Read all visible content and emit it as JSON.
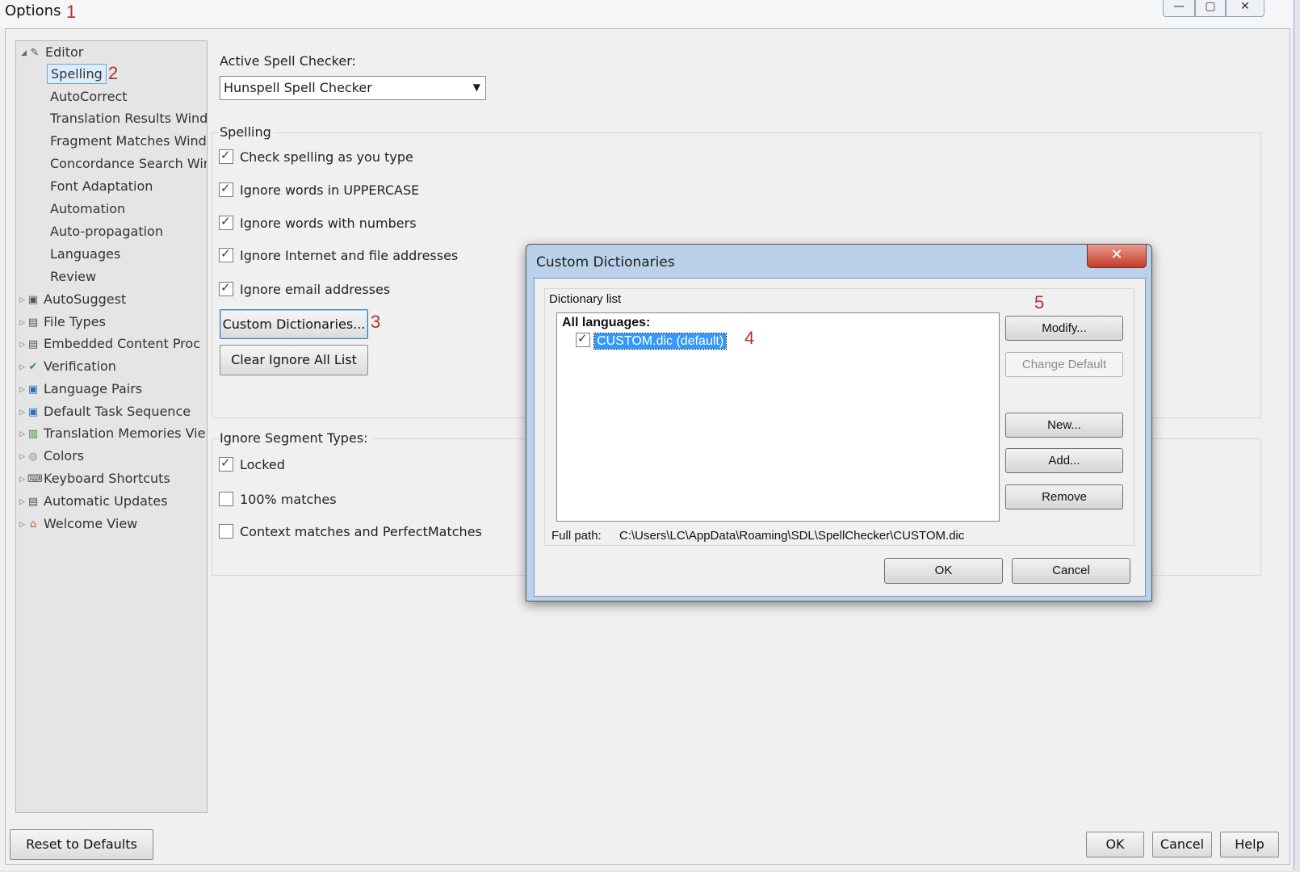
{
  "window": {
    "title": "Options",
    "controls": [
      "—",
      "▢",
      "✕"
    ]
  },
  "annotations": [
    "1",
    "2",
    "3",
    "4",
    "5"
  ],
  "tree": {
    "items": [
      {
        "label": "Editor",
        "icon": "pencil-icon",
        "expanded": true
      },
      {
        "label": "Spelling",
        "selected": true
      },
      {
        "label": "AutoCorrect"
      },
      {
        "label": "Translation Results Wind"
      },
      {
        "label": "Fragment Matches Wind"
      },
      {
        "label": "Concordance Search Win"
      },
      {
        "label": "Font Adaptation"
      },
      {
        "label": "Automation"
      },
      {
        "label": "Auto-propagation"
      },
      {
        "label": "Languages"
      },
      {
        "label": "Review"
      },
      {
        "label": "AutoSuggest",
        "icon": "autosuggest-icon"
      },
      {
        "label": "File Types",
        "icon": "file-types-icon"
      },
      {
        "label": "Embedded Content Proc",
        "icon": "embedded-content-icon"
      },
      {
        "label": "Verification",
        "icon": "verification-icon"
      },
      {
        "label": "Language Pairs",
        "icon": "language-pairs-icon"
      },
      {
        "label": "Default Task Sequence",
        "icon": "task-sequence-icon"
      },
      {
        "label": "Translation Memories Vie",
        "icon": "translation-memories-icon"
      },
      {
        "label": "Colors",
        "icon": "colors-icon"
      },
      {
        "label": "Keyboard Shortcuts",
        "icon": "keyboard-icon"
      },
      {
        "label": "Automatic Updates",
        "icon": "updates-icon"
      },
      {
        "label": "Welcome View",
        "icon": "home-icon"
      }
    ]
  },
  "spell": {
    "active_label": "Active Spell Checker:",
    "active_value": "Hunspell Spell Checker",
    "spelling_group": "Spelling",
    "options": [
      {
        "label": "Check spelling as you type",
        "checked": true
      },
      {
        "label": "Ignore words in UPPERCASE",
        "checked": true
      },
      {
        "label": "Ignore words with numbers",
        "checked": true
      },
      {
        "label": "Ignore Internet and file addresses",
        "checked": true
      },
      {
        "label": "Ignore email addresses",
        "checked": true
      }
    ],
    "custom_dict_button": "Custom Dictionaries...",
    "clear_ignore_button": "Clear Ignore All List",
    "ignore_group": "Ignore Segment Types:",
    "ignore_options": [
      {
        "label": "Locked",
        "checked": true
      },
      {
        "label": "100% matches",
        "checked": false
      },
      {
        "label": "Context matches and PerfectMatches",
        "checked": false
      }
    ]
  },
  "dialog": {
    "title": "Custom Dictionaries",
    "close": "✕",
    "group_label": "Dictionary list",
    "list_header": "All languages:",
    "dictionary": {
      "label": "CUSTOM.dic (default)",
      "checked": true
    },
    "buttons": {
      "modify": "Modify...",
      "change_default": "Change Default",
      "new": "New...",
      "add": "Add...",
      "remove": "Remove",
      "ok": "OK",
      "cancel": "Cancel"
    },
    "full_path_label": "Full path:",
    "full_path_value": "C:\\Users\\LC\\AppData\\Roaming\\SDL\\SpellChecker\\CUSTOM.dic"
  },
  "footer": {
    "reset": "Reset to Defaults",
    "ok": "OK",
    "cancel": "Cancel",
    "help": "Help"
  }
}
